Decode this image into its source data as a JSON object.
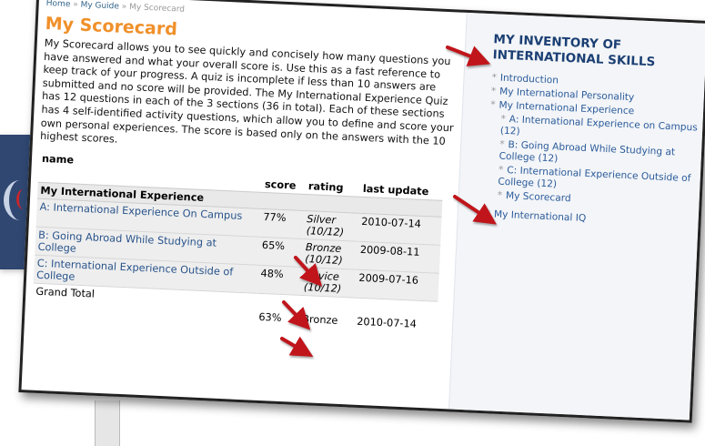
{
  "breadcrumb": {
    "home": "Home",
    "sep1": " » ",
    "guide": "My Guide",
    "sep2": " » ",
    "current": "My Scorecard"
  },
  "page": {
    "title": "My Scorecard",
    "intro": "My Scorecard allows you to see quickly and concisely how many questions you have answered and what your overall score is. Use this as a fast reference to keep track of your progress. A quiz is incomplete if less than 10 answers are submitted and no score will be provided. The My International Experience Quiz has 12 questions in each of the 3 sections (36 in total). Each of these sections has 4 self-identified activity questions, which allow you to define and score your own personal experiences. The score is based only on the answers with the 10 highest scores."
  },
  "table": {
    "headers": {
      "name": "name",
      "score": "score",
      "rating": "rating",
      "last_update": "last update"
    },
    "section": "My International Experience",
    "rows": [
      {
        "name": "A: International Experience On Campus",
        "score": "77%",
        "rating": "Silver",
        "count": "(10/12)",
        "date": "2010-07-14"
      },
      {
        "name": "B: Going Abroad While Studying at College",
        "score": "65%",
        "rating": "Bronze",
        "count": "(10/12)",
        "date": "2009-08-11"
      },
      {
        "name": "C: International Experience Outside of College",
        "score": "48%",
        "rating": "Novice",
        "count": "(10/12)",
        "date": "2009-07-16"
      }
    ],
    "total": {
      "name": "Grand Total",
      "score": "63%",
      "rating": "Bronze",
      "date": "2010-07-14"
    }
  },
  "sidebar": {
    "title": "MY INVENTORY OF INTERNATIONAL SKILLS",
    "bullet": "*",
    "items": [
      {
        "label": "Introduction"
      },
      {
        "label": "My International Personality"
      },
      {
        "label": "My International Experience"
      },
      {
        "label": "A: International Experience on Campus (12)"
      },
      {
        "label": "B: Going Abroad While Studying at College (12)"
      },
      {
        "label": "C: International Experience Outside of College (12)"
      },
      {
        "label": "My Scorecard"
      },
      {
        "label": "My International IQ"
      }
    ]
  },
  "colors": {
    "accent_orange": "#f0902a",
    "link_blue": "#28538a",
    "sidebar_title": "#1b3f73",
    "arrow_red": "#c0151b"
  }
}
